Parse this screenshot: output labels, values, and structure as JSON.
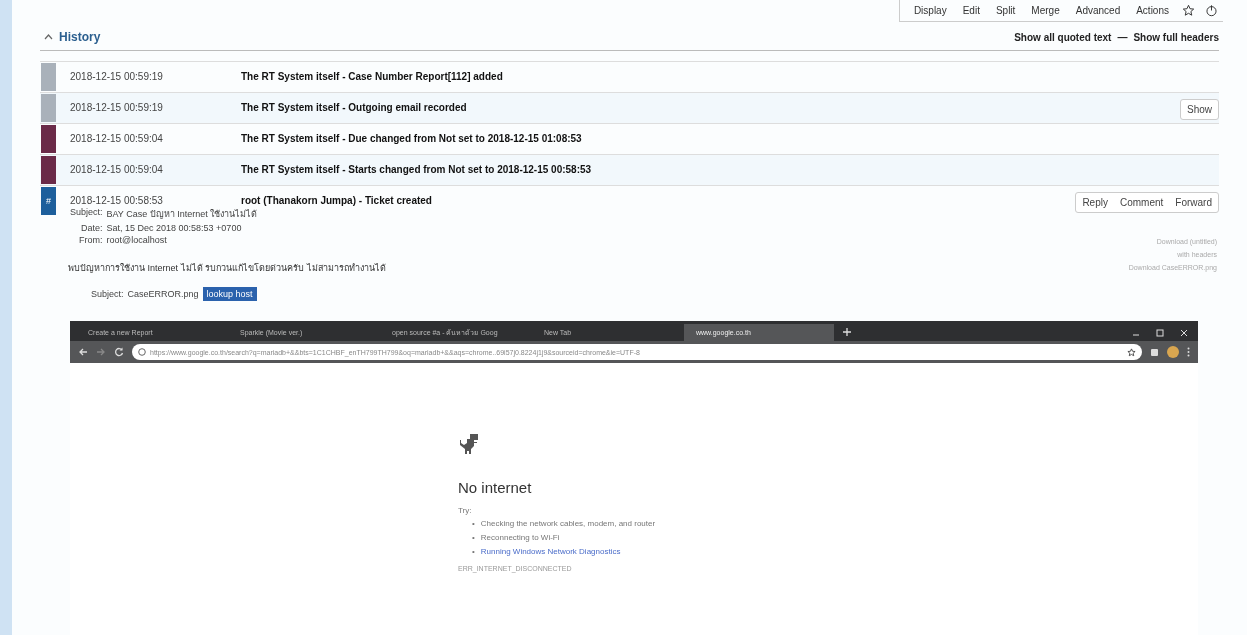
{
  "toolbar": {
    "items": [
      "Display",
      "Edit",
      "Split",
      "Merge",
      "Advanced",
      "Actions"
    ]
  },
  "history": {
    "title": "History",
    "links": [
      "Show all quoted text",
      "Show full headers"
    ],
    "separator": "—",
    "rows": [
      {
        "date": "2018-12-15 00:59:19",
        "description": "The RT System itself - Case Number Report[112] added",
        "color": "#a9b1ba",
        "buttons": []
      },
      {
        "date": "2018-12-15 00:59:19",
        "description": "The RT System itself - Outgoing email recorded",
        "color": "#a9b1ba",
        "buttons": [
          "Show"
        ]
      },
      {
        "date": "2018-12-15 00:59:04",
        "description": "The RT System itself - Due changed from Not set to 2018-12-15 01:08:53",
        "color": "#6a2a48",
        "buttons": []
      },
      {
        "date": "2018-12-15 00:59:04",
        "description": "The RT System itself - Starts changed from Not set to 2018-12-15 00:58:53",
        "color": "#6a2a48",
        "buttons": []
      },
      {
        "date": "2018-12-15 00:58:53",
        "description": "root (Thanakorn Jumpa) - Ticket created",
        "color": "#1d5f9c",
        "badge": "#",
        "buttons": [
          "Reply",
          "Comment",
          "Forward"
        ]
      }
    ]
  },
  "message": {
    "headers": [
      {
        "label": "Subject:",
        "value": "BAY Case  ปัญหา Internet ใช้งานไม่ได้"
      },
      {
        "label": "Date:",
        "value": "Sat, 15 Dec 2018 00:58:53 +0700"
      },
      {
        "label": "From:",
        "value": "root@localhost"
      }
    ],
    "body": "พบปัญหาการใช้งาน Internet ไม่ได้ รบกวนแก้ไขโดยด่วนครับ ไม่สามารถทำงานได้",
    "attachment": {
      "label": "Subject:",
      "value": "CaseERROR.png",
      "button": "lookup host"
    },
    "downloads": [
      "Download (untitled)",
      "with headers",
      "Download CaseERROR.png"
    ]
  },
  "browser": {
    "tabs": [
      {
        "title": "Create a new Report",
        "selected": false
      },
      {
        "title": "Sparkle (Movie ver.)",
        "selected": false
      },
      {
        "title": "open source #a - ค้นหาด้วย Goog",
        "selected": false
      },
      {
        "title": "New Tab",
        "selected": false
      },
      {
        "title": "www.google.co.th",
        "selected": true
      }
    ],
    "url": "https://www.google.co.th/search?q=mariadb+&&bts=1C1CHBF_enTH799TH799&oq=mariadb+&&aqs=chrome..69i57j0.8224j1j9&sourceid=chrome&ie=UTF-8",
    "page": {
      "title": "No internet",
      "try": "Try:",
      "suggestions": [
        {
          "bullet": "•",
          "text": "Checking the network cables, modem, and router",
          "link": false
        },
        {
          "bullet": "•",
          "text": "Reconnecting to Wi-Fi",
          "link": false
        },
        {
          "bullet": "•",
          "text": "Running Windows Network Diagnostics",
          "link": true
        }
      ],
      "error_code": "ERR_INTERNET_DISCONNECTED"
    }
  }
}
